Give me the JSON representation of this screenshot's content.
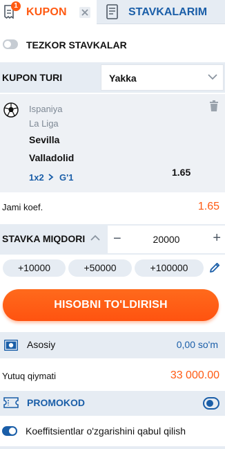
{
  "tabs": {
    "kupon_label": "KUPON",
    "kupon_badge": "1",
    "stavkalarim_label": "STAVKALARIM"
  },
  "tezkor": {
    "label": "TEZKOR STAVKALAR",
    "enabled": false
  },
  "kupon_turi": {
    "label": "KUPON TURI",
    "selected": "Yakka"
  },
  "event": {
    "country": "Ispaniya",
    "league": "La Liga",
    "home": "Sevilla",
    "away": "Valladolid",
    "market": "1x2",
    "outcome": "G'1",
    "odd": "1.65",
    "icons": [
      "football-icon",
      "trash-icon"
    ]
  },
  "jami": {
    "label": "Jami koef.",
    "value": "1.65"
  },
  "stake": {
    "label": "STAVKA MIQDORI",
    "minus": "−",
    "value": "20000",
    "plus": "+"
  },
  "quick_stakes": [
    "+10000",
    "+50000",
    "+100000"
  ],
  "cta": {
    "label": "HISOBNI TO'LDIRISH"
  },
  "account": {
    "label": "Asosiy",
    "value": "0,00 so'm"
  },
  "winnings": {
    "label": "Yutuq qiymati",
    "value": "33 000.00"
  },
  "promo": {
    "label": "PROMOKOD"
  },
  "accept_changes": {
    "label": "Koeffitsientlar o'zgarishini qabul qilish",
    "enabled": true
  },
  "colors": {
    "accent": "#ff5a12",
    "brand_blue": "#1a5ea8",
    "panel": "#e6ecf3"
  }
}
